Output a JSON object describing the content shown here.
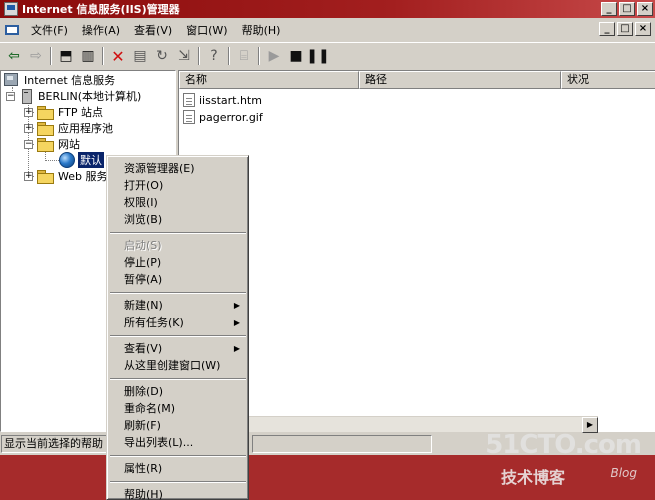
{
  "window": {
    "title": "Internet 信息服务(IIS)管理器",
    "controls": [
      "_",
      "□",
      "×"
    ]
  },
  "menubar": {
    "items": [
      "文件(F)",
      "操作(A)",
      "查看(V)",
      "窗口(W)",
      "帮助(H)"
    ],
    "mdi_controls": [
      "_",
      "□",
      "×"
    ]
  },
  "toolbar": {
    "buttons": [
      "back-arrow",
      "forward-arrow",
      "up-folder",
      "show-tree",
      "delete",
      "properties",
      "refresh",
      "export-list",
      "help",
      "connect",
      "start",
      "stop",
      "pause"
    ]
  },
  "tree": {
    "root": "Internet 信息服务",
    "server": "BERLIN(本地计算机)",
    "nodes": [
      "FTP 站点",
      "应用程序池",
      "网站",
      "默认网站",
      "Web 服务扩展"
    ],
    "visible_labels": {
      "ftp": "FTP 站点",
      "apppools": "应用程序池",
      "websites": "网站",
      "default_site": "默认",
      "web_ext": "Web 服务"
    }
  },
  "list": {
    "columns": [
      "名称",
      "路径",
      "状况"
    ],
    "files": [
      "iisstart.htm",
      "pagerror.gif"
    ]
  },
  "context_menu": {
    "groups": [
      [
        "资源管理器(E)",
        "打开(O)",
        "权限(I)",
        "浏览(B)"
      ],
      [
        "启动(S)",
        "停止(P)",
        "暂停(A)"
      ],
      [
        "新建(N)",
        "所有任务(K)"
      ],
      [
        "查看(V)",
        "从这里创建窗口(W)"
      ],
      [
        "删除(D)",
        "重命名(M)",
        "刷新(F)",
        "导出列表(L)..."
      ],
      [
        "属性(R)"
      ],
      [
        "帮助(H)"
      ]
    ],
    "disabled": [
      "启动(S)"
    ],
    "submenus": [
      "新建(N)",
      "所有任务(K)",
      "查看(V)"
    ]
  },
  "statusbar": {
    "text": "显示当前选择的帮助"
  },
  "watermark": {
    "main": "51CTO.com",
    "sub": "技术博客",
    "blog": "Blog"
  },
  "colors": {
    "title_bar": "#8a0b0b",
    "desktop": "#a62b2b",
    "selection": "#0a246a",
    "face": "#d4d0c8"
  }
}
